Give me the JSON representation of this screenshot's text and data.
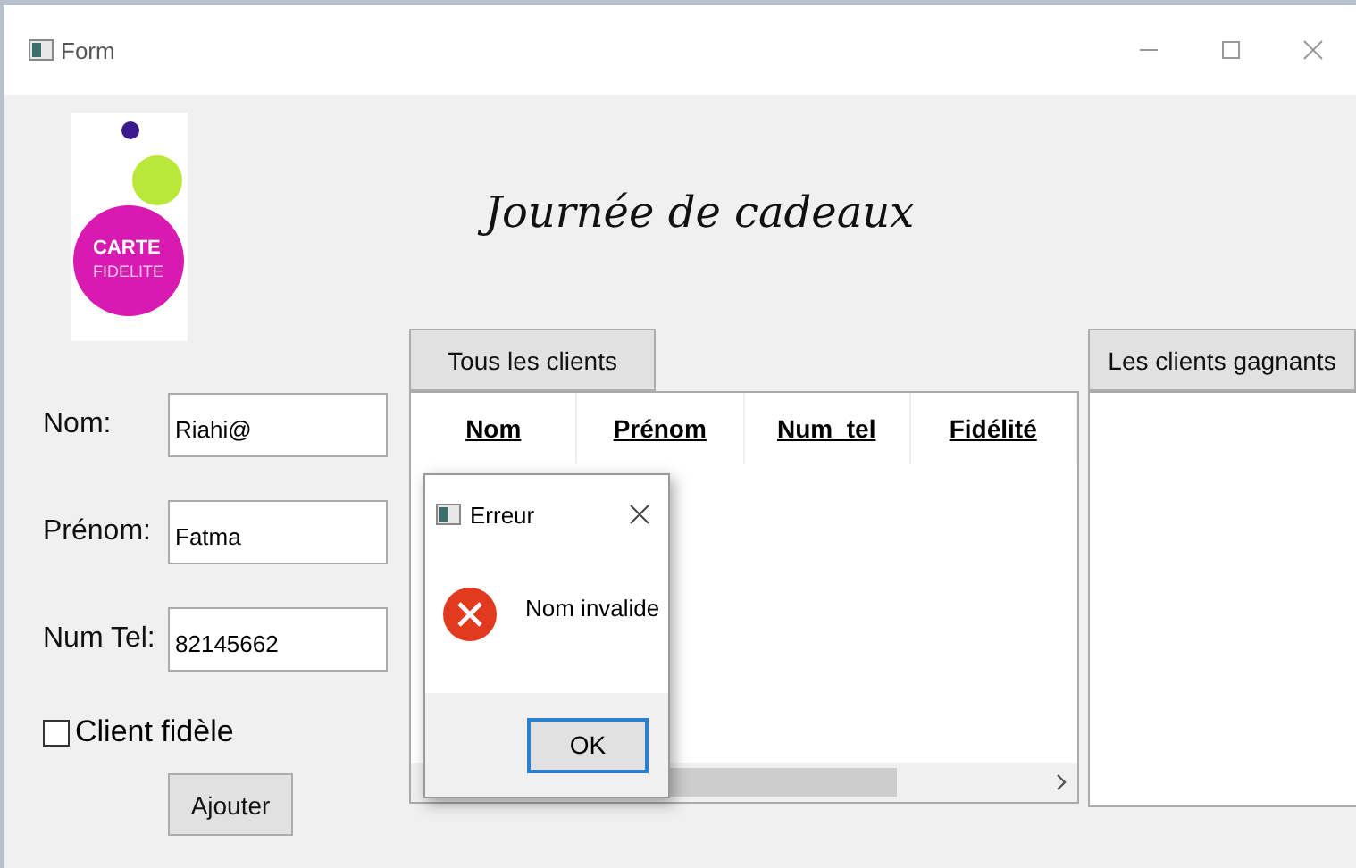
{
  "window": {
    "title": "Form"
  },
  "logo": {
    "line_1": "CARTE",
    "line_2": "FIDELITE"
  },
  "heading": "Journée de cadeaux",
  "form": {
    "fields": [
      {
        "label": "Nom:",
        "value": "Riahi@"
      },
      {
        "label": "Prénom:",
        "value": "Fatma"
      },
      {
        "label": "Num Tel:",
        "value": "82145662"
      }
    ],
    "checkbox": {
      "label": "Client fidèle",
      "checked": false
    },
    "submit": "Ajouter"
  },
  "all_clients": {
    "button": "Tous les clients",
    "table": {
      "columns": [
        "Nom",
        "Prénom",
        "Num_tel",
        "Fidélité"
      ]
    }
  },
  "winners": {
    "button": "Les clients gagnants"
  },
  "dialog": {
    "title": "Erreur",
    "message": "Nom invalide",
    "button": "OK"
  }
}
